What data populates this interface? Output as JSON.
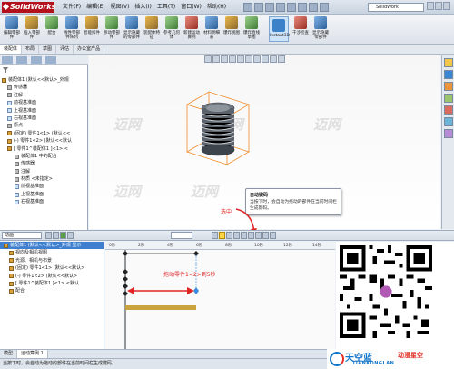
{
  "app": {
    "logo": "SolidWorks"
  },
  "menu": [
    "文件(F)",
    "编辑(E)",
    "视图(V)",
    "插入(I)",
    "工具(T)",
    "窗口(W)",
    "帮助(H)"
  ],
  "search": {
    "placeholder": "SolidWork"
  },
  "ribbon": {
    "buttons": [
      "编辑零部件",
      "插入零部件",
      "配合",
      "线性零部件阵列",
      "智能扣件",
      "移动零部件",
      "显示隐藏的零部件",
      "装配体特征",
      "参考几何体",
      "新建运动算例",
      "材料明细表",
      "爆炸视图",
      "爆炸直线草图",
      "干涉检查",
      "显示隐藏零部件"
    ],
    "instant3d": "Instant3D"
  },
  "command_tabs": [
    "装配体",
    "布局",
    "草图",
    "评估",
    "办公室产品"
  ],
  "feature_tree": [
    "装配体1 (默认<<默认>_外观",
    "传感器",
    "注解",
    "前视基准面",
    "上视基准面",
    "右视基准面",
    "原点",
    "(固定) 零件1<1> (默认<<",
    "(-) 零件1<2> (默认<<默认",
    "[ 零件1^装配体1 ]<1> <",
    "装配体1 中的配合",
    "传感器",
    "注解",
    "材质 <未指定>",
    "前视基准面",
    "上视基准面",
    "右视基准面"
  ],
  "tooltip": {
    "title": "自动键码",
    "text": "当按下时，会自动为拖动的部件在当前时间栏生成键码。"
  },
  "callout_select": "选中",
  "callout_drag": "拖动零件1<2>到5秒",
  "watermark": "迈网",
  "animation": {
    "combo": "动画",
    "tree": [
      "装配体1 (默认<<默认>_外观 显示",
      "视向及相机视图",
      "光源、相机与布景",
      "(固定) 零件1<1> (默认<<默认>",
      "(-) 零件1<2> (默认<<默认>",
      "[ 零件1^装配体1 ]<1> <默认",
      "配合"
    ],
    "ruler": [
      "0秒",
      "2秒",
      "4秒",
      "6秒",
      "8秒",
      "10秒",
      "12秒",
      "14秒"
    ]
  },
  "bottom_tabs": [
    "模型",
    "运动算例 1"
  ],
  "status": "当按下时，会自动为拖动的部件在当前时间栏生成键码。",
  "brand": {
    "cn": "天空蓝",
    "cn2": "动漫星空",
    "en": "TIANKONGLAN"
  },
  "colors": {
    "accent": "#e02424",
    "brand_blue": "#1476c9",
    "selection": "#3f7fcf",
    "bbox": "#f08a28",
    "timebar": "#c9a43e"
  }
}
